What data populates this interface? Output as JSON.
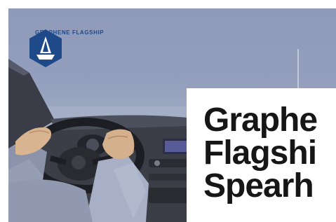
{
  "brand": {
    "logo_text": "GRAPHENE FLAGSHIP",
    "logo_color": "#1f4a8a"
  },
  "headline": {
    "lines": [
      "Graphe",
      "Flagshi",
      "Spearh"
    ],
    "color": "#161616"
  },
  "photo": {
    "subject": "driver hands on steering wheel"
  }
}
